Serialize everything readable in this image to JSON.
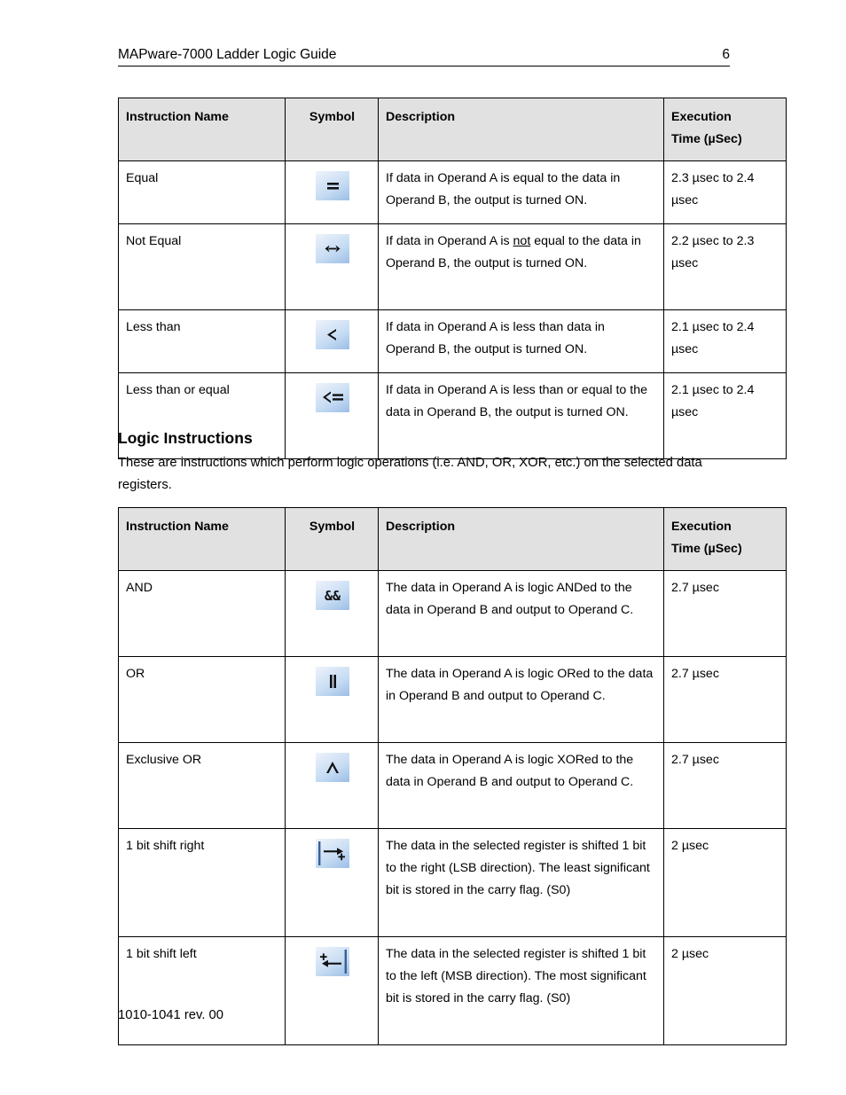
{
  "header": {
    "title": "MAPware-7000 Ladder Logic Guide",
    "page_number": "6"
  },
  "compare_table": {
    "columns": {
      "name": "Instruction Name",
      "symbol": "Symbol",
      "description": "Description",
      "execution_line1": "Execution",
      "execution_line2": "Time (µSec)"
    },
    "rows": [
      {
        "name": "Equal",
        "symbol_icon": "equals-icon",
        "symbol_glyph": "=",
        "description_pre": "If data in Operand A is equal to the data in Operand B, the output is turned ON.",
        "description_underline": "",
        "description_post": "",
        "execution": "2.3 µsec to 2.4 µsec"
      },
      {
        "name": "Not Equal",
        "symbol_icon": "not-equal-icon",
        "symbol_glyph": "<>",
        "description_pre": "If data in Operand A is ",
        "description_underline": "not",
        "description_post": " equal to the data in Operand B, the output is turned ON.",
        "execution": "2.2 µsec to 2.3 µsec"
      },
      {
        "name": "Less than",
        "symbol_icon": "less-than-icon",
        "symbol_glyph": "<",
        "description_pre": "If data in Operand A is less than data in Operand B, the output is turned ON.",
        "description_underline": "",
        "description_post": "",
        "execution": "2.1 µsec to 2.4 µsec"
      },
      {
        "name": "Less than or equal",
        "symbol_icon": "less-than-or-equal-icon",
        "symbol_glyph": "<=",
        "description_pre": "If data in Operand A is less than or equal to the data in Operand B, the output is turned ON.",
        "description_underline": "",
        "description_post": "",
        "execution": "2.1 µsec to 2.4 µsec"
      }
    ]
  },
  "logic_section": {
    "heading": "Logic Instructions",
    "paragraph": "These are instructions which perform logic operations (i.e. AND, OR, XOR, etc.) on the selected data registers."
  },
  "logic_table": {
    "columns": {
      "name": "Instruction Name",
      "symbol": "Symbol",
      "description": "Description",
      "execution_line1": "Execution",
      "execution_line2": "Time (µSec)"
    },
    "rows": [
      {
        "name": "AND",
        "symbol_icon": "logical-and-icon",
        "symbol_glyph": "&&",
        "description": "The data in Operand A is logic ANDed to the data in Operand B and output to Operand C.",
        "execution": "2.7 µsec"
      },
      {
        "name": "OR",
        "symbol_icon": "logical-or-icon",
        "symbol_glyph": "||",
        "description": "The data in Operand A is logic ORed to the data in Operand B and output to Operand C.",
        "execution": "2.7 µsec"
      },
      {
        "name": "Exclusive OR",
        "symbol_icon": "logical-xor-icon",
        "symbol_glyph": "^",
        "description": "The data in Operand A is logic XORed to the data in Operand B and output to Operand C.",
        "execution": "2.7 µsec"
      },
      {
        "name": "1 bit shift right",
        "symbol_icon": "shift-right-icon",
        "symbol_glyph": "→",
        "description": "The data in the selected register is shifted 1 bit to the right (LSB direction). The least significant bit is stored in the carry flag. (S0)",
        "execution": "2 µsec"
      },
      {
        "name": "1 bit shift left",
        "symbol_icon": "shift-left-icon",
        "symbol_glyph": "←",
        "description": "The data in the selected register is shifted 1 bit to the left (MSB direction). The most significant bit is stored in the carry flag. (S0)",
        "execution": "2 µsec"
      }
    ]
  },
  "footer": {
    "document_id": "1010-1041 rev. 00"
  },
  "colors": {
    "header_row_background": "#e1e1e1",
    "border": "#000000",
    "icon_gradient_light": "#eef3fb",
    "icon_gradient_dark": "#9dbde6",
    "text": "#000000"
  }
}
